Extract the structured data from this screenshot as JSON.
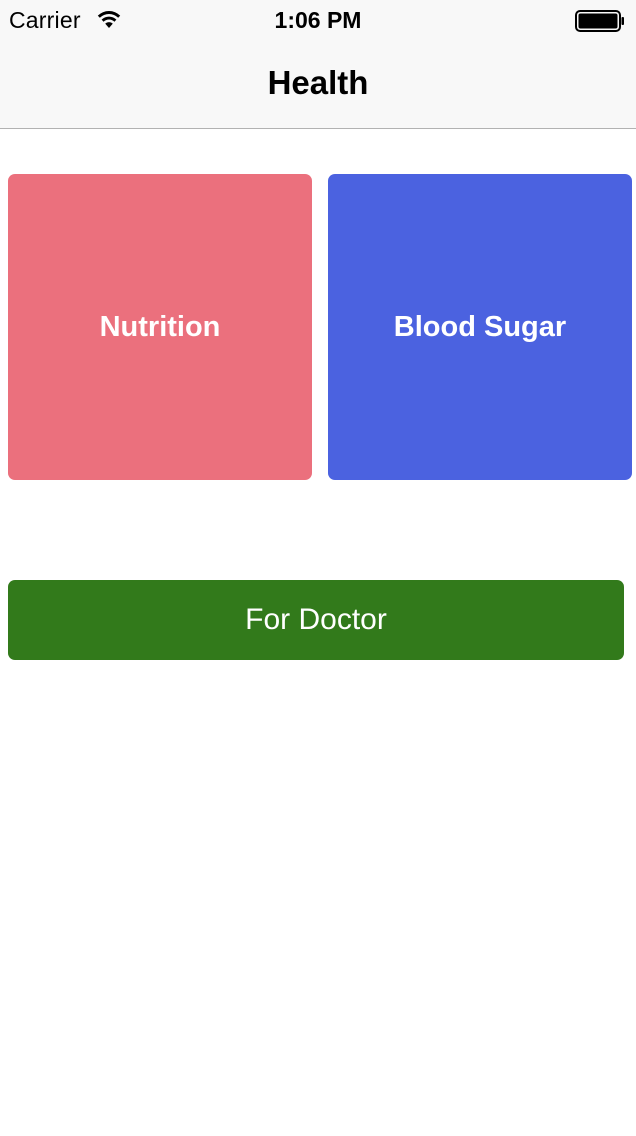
{
  "status_bar": {
    "carrier": "Carrier",
    "time": "1:06 PM",
    "icons": [
      "wifi-icon",
      "battery-icon"
    ]
  },
  "nav_bar": {
    "title": "Health"
  },
  "tiles": [
    {
      "label": "Nutrition",
      "color": "#eb707d"
    },
    {
      "label": "Blood Sugar",
      "color": "#4b62e0"
    }
  ],
  "doctor_button": {
    "label": "For Doctor",
    "color": "#327a1b"
  }
}
